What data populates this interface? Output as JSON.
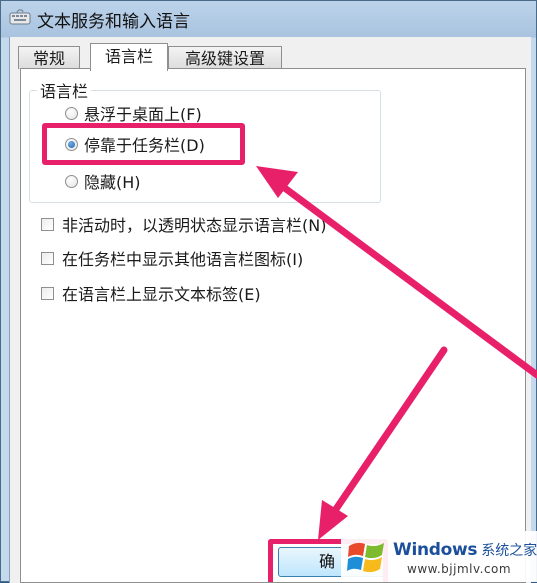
{
  "window": {
    "title": "文本服务和输入语言"
  },
  "tabs": [
    {
      "label": "常规",
      "active": false
    },
    {
      "label": "语言栏",
      "active": true
    },
    {
      "label": "高级键设置",
      "active": false
    }
  ],
  "language_bar_group": {
    "legend": "语言栏",
    "options": [
      {
        "label": "悬浮于桌面上(F)",
        "checked": false
      },
      {
        "label": "停靠于任务栏(D)",
        "checked": true
      },
      {
        "label": "隐藏(H)",
        "checked": false
      }
    ]
  },
  "checkboxes": [
    {
      "label": "非活动时，以透明状态显示语言栏(N)",
      "checked": false
    },
    {
      "label": "在任务栏中显示其他语言栏图标(I)",
      "checked": false
    },
    {
      "label": "在语言栏上显示文本标签(E)",
      "checked": false
    }
  ],
  "buttons": {
    "ok_label": "确"
  },
  "annotation": {
    "color": "#e8206a"
  },
  "watermark": {
    "brand": "Windows",
    "site": "系统之家",
    "url": "www.bjjmlv.com"
  }
}
